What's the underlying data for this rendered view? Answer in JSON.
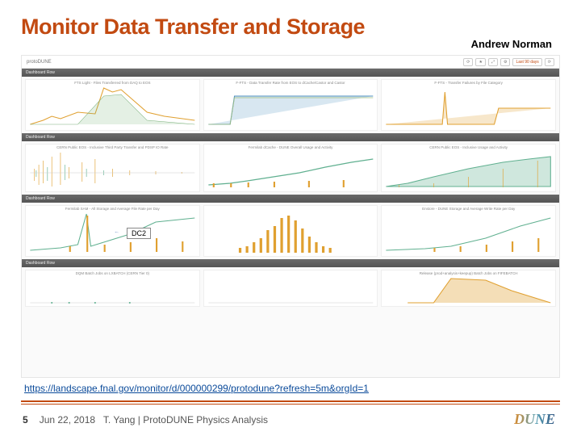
{
  "title": "Monitor Data Transfer and Storage",
  "author": "Andrew Norman",
  "dashboard": {
    "brand": "protoDUNE",
    "timerange": "Last 90 days",
    "section_label": "Dashboard Row",
    "panels_row1": [
      "FTS Light - Files Transferred from DAQ to EOS",
      "F-FTS - Data Transfer Rate from EOS to dCache/Castor and Castor",
      "F-FTS - Transfer Failures by File Category"
    ],
    "panels_row2": [
      "CERN Public EOS - Inclusive Third Party Transfer and PDSP IO Rate",
      "Fermilab dCache - DUNE Overall Usage and Activity",
      "CERN Public EOS - Inclusive Usage and Activity"
    ],
    "panels_row3": [
      "Fermilab SAM - All Storage and Average File Rate per Day",
      "",
      "Enstore - DUNE Storage and Average Write Rate per Day"
    ],
    "panels_row4": [
      "DQM Batch Jobs on LXBATCH (CERN Tier 0)",
      "",
      "Release (prod+analysis+keepup) Batch Jobs on FIFEBATCH"
    ]
  },
  "annotation": "DC2",
  "url": "https://landscape.fnal.gov/monitor/d/000000299/protodune?refresh=5m&orgId=1",
  "footer": {
    "page": "5",
    "date": "Jun 22, 2018",
    "attribution": "T. Yang | ProtoDUNE Physics Analysis",
    "logo": "DUNE"
  }
}
